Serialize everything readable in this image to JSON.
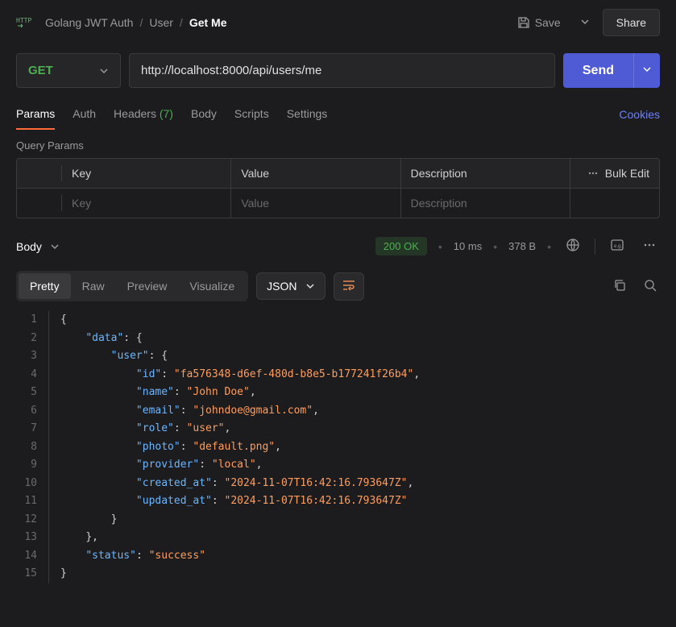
{
  "breadcrumb": {
    "collection": "Golang JWT Auth",
    "folder": "User",
    "request": "Get Me"
  },
  "actions": {
    "save": "Save",
    "share": "Share"
  },
  "request": {
    "method": "GET",
    "url": "http://localhost:8000/api/users/me",
    "send": "Send"
  },
  "tabs": {
    "params": "Params",
    "auth": "Auth",
    "headers": "Headers",
    "headers_count": "(7)",
    "body": "Body",
    "scripts": "Scripts",
    "settings": "Settings",
    "cookies": "Cookies"
  },
  "params_section": {
    "title": "Query Params",
    "col_key": "Key",
    "col_value": "Value",
    "col_desc": "Description",
    "bulk_edit": "Bulk Edit",
    "ph_key": "Key",
    "ph_value": "Value",
    "ph_desc": "Description"
  },
  "response": {
    "body_label": "Body",
    "status": "200 OK",
    "time": "10 ms",
    "size": "378 B",
    "view_pretty": "Pretty",
    "view_raw": "Raw",
    "view_preview": "Preview",
    "view_visualize": "Visualize",
    "format": "JSON"
  },
  "json_body": {
    "lines": [
      {
        "n": 1,
        "indent": 0,
        "tokens": [
          {
            "t": "punc",
            "v": "{"
          }
        ]
      },
      {
        "n": 2,
        "indent": 1,
        "tokens": [
          {
            "t": "key",
            "v": "\"data\""
          },
          {
            "t": "punc",
            "v": ": {"
          }
        ]
      },
      {
        "n": 3,
        "indent": 2,
        "tokens": [
          {
            "t": "key",
            "v": "\"user\""
          },
          {
            "t": "punc",
            "v": ": {"
          }
        ]
      },
      {
        "n": 4,
        "indent": 3,
        "tokens": [
          {
            "t": "key",
            "v": "\"id\""
          },
          {
            "t": "punc",
            "v": ": "
          },
          {
            "t": "str",
            "v": "\"fa576348-d6ef-480d-b8e5-b177241f26b4\""
          },
          {
            "t": "punc",
            "v": ","
          }
        ]
      },
      {
        "n": 5,
        "indent": 3,
        "tokens": [
          {
            "t": "key",
            "v": "\"name\""
          },
          {
            "t": "punc",
            "v": ": "
          },
          {
            "t": "str",
            "v": "\"John Doe\""
          },
          {
            "t": "punc",
            "v": ","
          }
        ]
      },
      {
        "n": 6,
        "indent": 3,
        "tokens": [
          {
            "t": "key",
            "v": "\"email\""
          },
          {
            "t": "punc",
            "v": ": "
          },
          {
            "t": "str",
            "v": "\"johndoe@gmail.com\""
          },
          {
            "t": "punc",
            "v": ","
          }
        ]
      },
      {
        "n": 7,
        "indent": 3,
        "tokens": [
          {
            "t": "key",
            "v": "\"role\""
          },
          {
            "t": "punc",
            "v": ": "
          },
          {
            "t": "str",
            "v": "\"user\""
          },
          {
            "t": "punc",
            "v": ","
          }
        ]
      },
      {
        "n": 8,
        "indent": 3,
        "tokens": [
          {
            "t": "key",
            "v": "\"photo\""
          },
          {
            "t": "punc",
            "v": ": "
          },
          {
            "t": "str",
            "v": "\"default.png\""
          },
          {
            "t": "punc",
            "v": ","
          }
        ]
      },
      {
        "n": 9,
        "indent": 3,
        "tokens": [
          {
            "t": "key",
            "v": "\"provider\""
          },
          {
            "t": "punc",
            "v": ": "
          },
          {
            "t": "str",
            "v": "\"local\""
          },
          {
            "t": "punc",
            "v": ","
          }
        ]
      },
      {
        "n": 10,
        "indent": 3,
        "tokens": [
          {
            "t": "key",
            "v": "\"created_at\""
          },
          {
            "t": "punc",
            "v": ": "
          },
          {
            "t": "str",
            "v": "\"2024-11-07T16:42:16.793647Z\""
          },
          {
            "t": "punc",
            "v": ","
          }
        ]
      },
      {
        "n": 11,
        "indent": 3,
        "tokens": [
          {
            "t": "key",
            "v": "\"updated_at\""
          },
          {
            "t": "punc",
            "v": ": "
          },
          {
            "t": "str",
            "v": "\"2024-11-07T16:42:16.793647Z\""
          }
        ]
      },
      {
        "n": 12,
        "indent": 2,
        "tokens": [
          {
            "t": "punc",
            "v": "}"
          }
        ]
      },
      {
        "n": 13,
        "indent": 1,
        "tokens": [
          {
            "t": "punc",
            "v": "},"
          }
        ]
      },
      {
        "n": 14,
        "indent": 1,
        "tokens": [
          {
            "t": "key",
            "v": "\"status\""
          },
          {
            "t": "punc",
            "v": ": "
          },
          {
            "t": "str",
            "v": "\"success\""
          }
        ]
      },
      {
        "n": 15,
        "indent": 0,
        "tokens": [
          {
            "t": "punc",
            "v": "}"
          }
        ]
      }
    ]
  }
}
